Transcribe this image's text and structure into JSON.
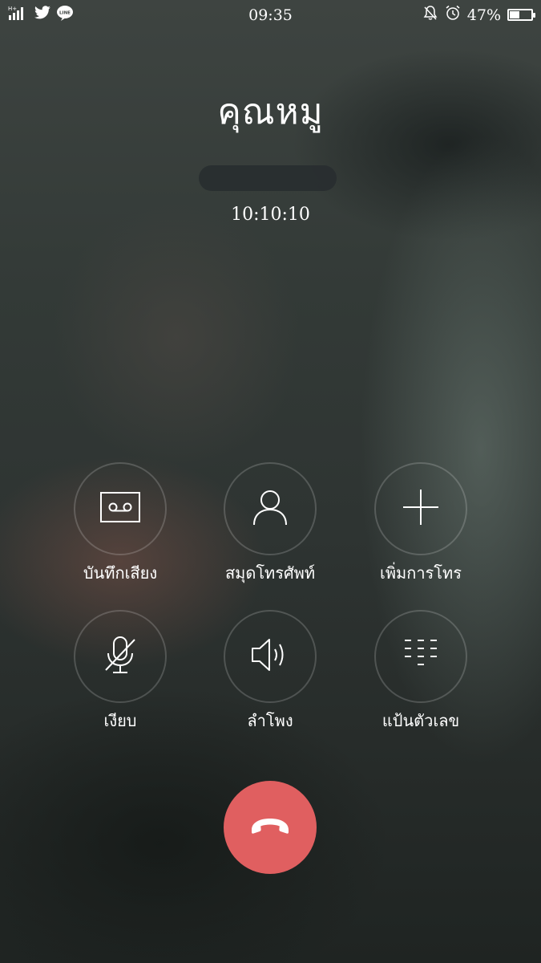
{
  "status_bar": {
    "time": "09:35",
    "battery": "47%",
    "battery_level": 0.47,
    "network_label": "H+",
    "icons": [
      "signal-icon",
      "twitter-icon",
      "line-icon",
      "silent-bell-icon",
      "alarm-icon",
      "battery-icon"
    ]
  },
  "call": {
    "caller_name": "คุณหมู",
    "duration": "10:10:10"
  },
  "controls": [
    {
      "label": "บันทึกเสียง",
      "icon": "voicemail-record-icon"
    },
    {
      "label": "สมุดโทรศัพท์",
      "icon": "contact-person-icon"
    },
    {
      "label": "เพิ่มการโทร",
      "icon": "plus-icon"
    },
    {
      "label": "เงียบ",
      "icon": "mic-muted-icon"
    },
    {
      "label": "ลำโพง",
      "icon": "speaker-icon"
    },
    {
      "label": "แป้นตัวเลข",
      "icon": "dialpad-icon"
    }
  ],
  "end_call": {
    "icon": "end-call-phone-icon",
    "color": "#e05f60"
  }
}
